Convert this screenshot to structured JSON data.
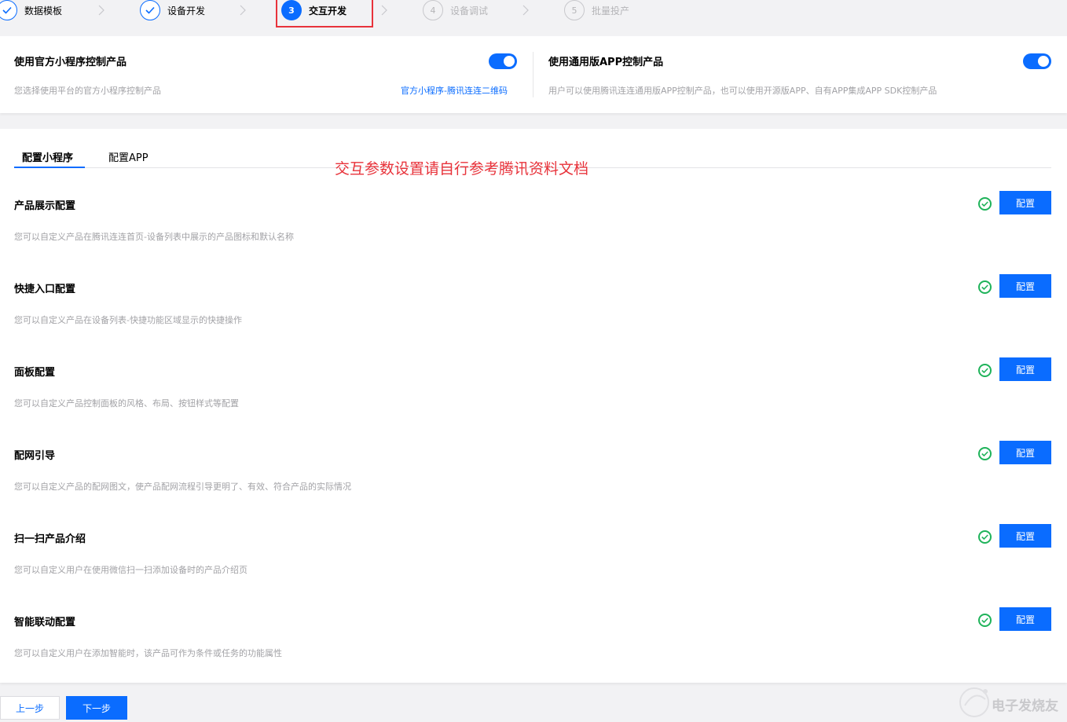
{
  "stepper": {
    "steps": [
      {
        "number": "",
        "label": "数据模板",
        "state": "done"
      },
      {
        "number": "",
        "label": "设备开发",
        "state": "done"
      },
      {
        "number": "3",
        "label": "交互开发",
        "state": "active"
      },
      {
        "number": "4",
        "label": "设备调试",
        "state": "pending"
      },
      {
        "number": "5",
        "label": "批量投产",
        "state": "pending"
      }
    ]
  },
  "control": {
    "mini": {
      "title": "使用官方小程序控制产品",
      "desc": "您选择使用平台的官方小程序控制产品",
      "link": "官方小程序-腾讯连连二维码",
      "enabled": true
    },
    "app": {
      "title": "使用通用版APP控制产品",
      "desc": "用户可以使用腾讯连连通用版APP控制产品，也可以使用开源版APP、自有APP集成APP SDK控制产品",
      "enabled": true
    }
  },
  "tabs": [
    {
      "label": "配置小程序",
      "active": true
    },
    {
      "label": "配置APP",
      "active": false
    }
  ],
  "annotation": "交互参数设置请自行参考腾讯资料文档",
  "configs": [
    {
      "title": "产品展示配置",
      "desc": "您可以自定义产品在腾讯连连首页-设备列表中展示的产品图标和默认名称",
      "button": "配置",
      "status": "check-circle-icon"
    },
    {
      "title": "快捷入口配置",
      "desc": "您可以自定义产品在设备列表-快捷功能区域显示的快捷操作",
      "button": "配置",
      "status": "check-circle-icon"
    },
    {
      "title": "面板配置",
      "desc": "您可以自定义产品控制面板的风格、布局、按钮样式等配置",
      "button": "配置",
      "status": "check-circle-icon"
    },
    {
      "title": "配网引导",
      "desc": "您可以自定义产品的配网图文，使产品配网流程引导更明了、有效、符合产品的实际情况",
      "button": "配置",
      "status": "check-circle-icon"
    },
    {
      "title": "扫一扫产品介绍",
      "desc": "您可以自定义用户在使用微信扫一扫添加设备时的产品介绍页",
      "button": "配置",
      "status": "check-circle-icon"
    },
    {
      "title": "智能联动配置",
      "desc": "您可以自定义用户在添加智能时，该产品可作为条件或任务的功能属性",
      "button": "配置",
      "status": "check-circle-icon"
    }
  ],
  "footer": {
    "prev": "上一步",
    "next": "下一步"
  },
  "watermark": "电子发烧友",
  "colors": {
    "primary": "#0a6cff",
    "success": "#1fb35a",
    "annotation": "#e8333b",
    "muted": "#a2a2a6"
  }
}
